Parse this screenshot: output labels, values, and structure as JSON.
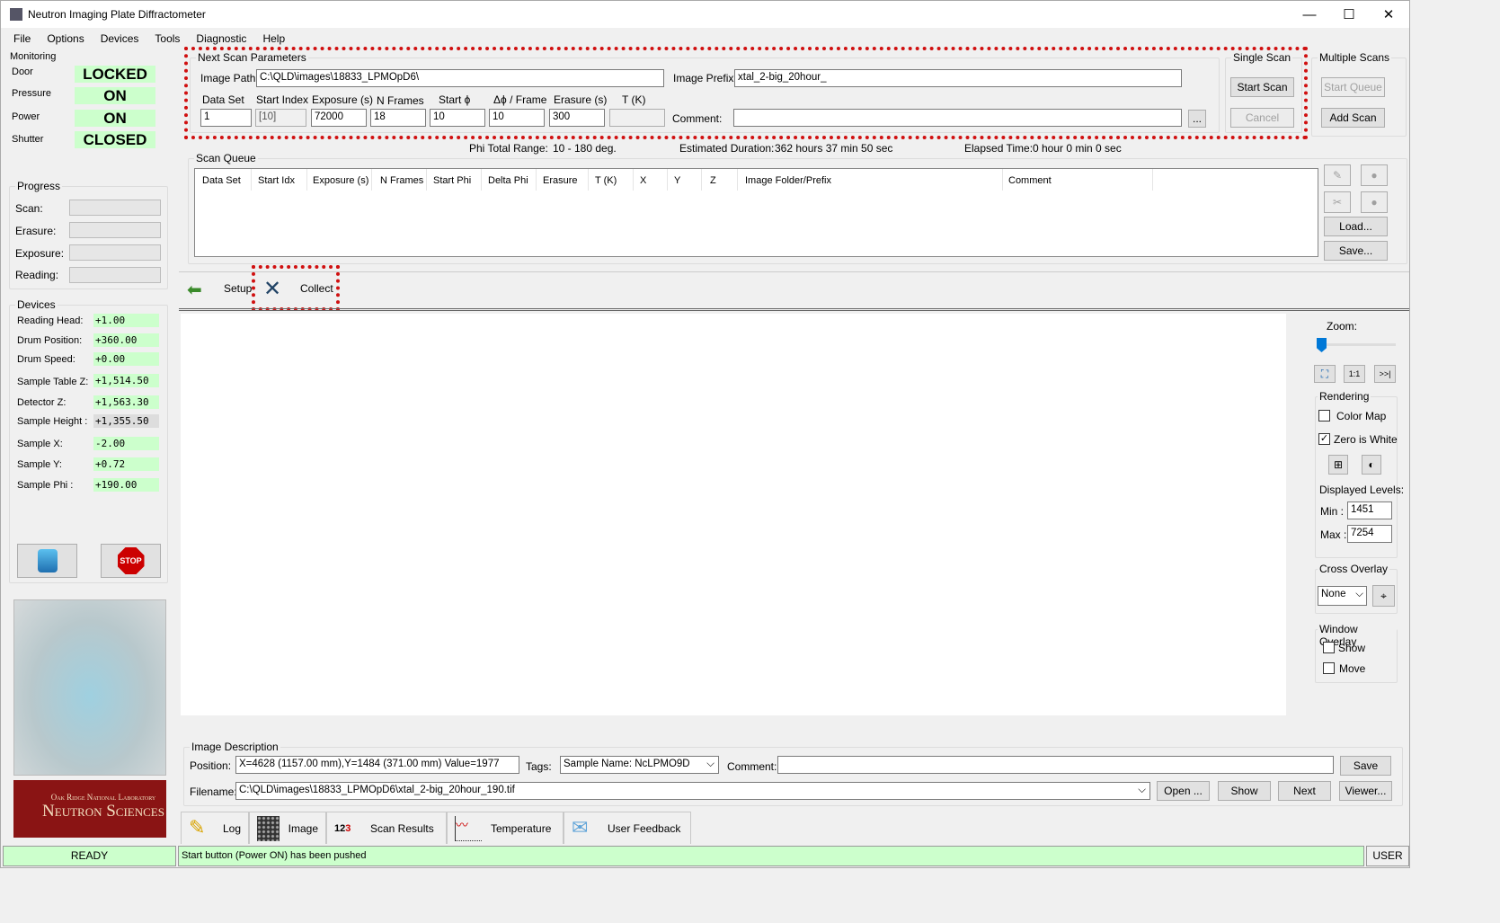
{
  "window": {
    "title": "Neutron Imaging Plate Diffractometer",
    "minimize": "—",
    "maximize": "☐",
    "close": "✕"
  },
  "menu": [
    "File",
    "Options",
    "Devices",
    "Tools",
    "Diagnostic",
    "Help"
  ],
  "monitoring": {
    "label": "Monitoring",
    "items": [
      {
        "label": "Door",
        "value": "LOCKED"
      },
      {
        "label": "Pressure",
        "value": "ON"
      },
      {
        "label": "Power",
        "value": "ON"
      },
      {
        "label": "Shutter",
        "value": "CLOSED"
      }
    ]
  },
  "progress": {
    "label": "Progress",
    "items": [
      "Scan:",
      "Erasure:",
      "Exposure:",
      "Reading:"
    ]
  },
  "devices": {
    "label": "Devices",
    "items": [
      {
        "label": "Reading Head:",
        "value": "+1.00"
      },
      {
        "label": "Drum Position:",
        "value": "+360.00"
      },
      {
        "label": "Drum Speed:",
        "value": "+0.00"
      },
      {
        "label": "Sample Table Z:",
        "value": "+1,514.50"
      },
      {
        "label": "Detector Z:",
        "value": "+1,563.30"
      },
      {
        "label": "Sample Height :",
        "value": "+1,355.50"
      },
      {
        "label": "Sample X:",
        "value": "-2.00"
      },
      {
        "label": "Sample Y:",
        "value": "+0.72"
      },
      {
        "label": "Sample Phi :",
        "value": "+190.00"
      }
    ]
  },
  "stop_label": "STOP",
  "logo": {
    "line1": "Oak Ridge National Laboratory",
    "line2": "Neutron Sciences"
  },
  "next_scan": {
    "label": "Next Scan Parameters",
    "image_path_label": "Image Path:",
    "image_path": "C:\\QLD\\images\\18833_LPMOpD6\\",
    "image_prefix_label": "Image Prefix:",
    "image_prefix": "xtal_2-big_20hour_",
    "fields": [
      {
        "label": "Data Set",
        "value": "1"
      },
      {
        "label": "Start Index",
        "value": "[10]"
      },
      {
        "label": "Exposure (s)",
        "value": "72000"
      },
      {
        "label": "N Frames",
        "value": "18"
      },
      {
        "label": "Start ϕ",
        "value": "10"
      },
      {
        "label": "Δϕ / Frame",
        "value": "10"
      },
      {
        "label": "Erasure (s)",
        "value": "300"
      },
      {
        "label": "T (K)",
        "value": ""
      }
    ],
    "comment_label": "Comment:",
    "comment": "",
    "browse": "..."
  },
  "single_scan": {
    "label": "Single Scan",
    "start": "Start Scan",
    "cancel": "Cancel"
  },
  "multiple_scans": {
    "label": "Multiple Scans",
    "start_queue": "Start Queue",
    "add_scan": "Add Scan"
  },
  "info": {
    "phi_label": "Phi Total Range:",
    "phi": "10 - 180 deg.",
    "dur_label": "Estimated Duration:",
    "dur": "362 hours 37 min 50 sec",
    "elapsed_label": "Elapsed Time:",
    "elapsed": "0 hour 0 min 0 sec"
  },
  "queue": {
    "label": "Scan Queue",
    "columns": [
      "Data Set",
      "Start Idx",
      "Exposure (s)",
      "N Frames",
      "Start Phi",
      "Delta Phi",
      "Erasure",
      "T (K)",
      "X",
      "Y",
      "Z",
      "Image Folder/Prefix",
      "Comment"
    ],
    "load": "Load...",
    "save": "Save..."
  },
  "nav": {
    "setup": "Setup",
    "collect": "Collect"
  },
  "viewer": {
    "zoom_label": "Zoom:",
    "zoom_fit": "⛶",
    "zoom_1to1": "1:1",
    "zoom_next": ">>|",
    "zoom_value": 0,
    "rendering": "Rendering",
    "color_map": "Color Map",
    "color_map_checked": false,
    "zero_white": "Zero is White",
    "zero_white_checked": true,
    "levels": "Displayed Levels:",
    "min_label": "Min :",
    "min": "1451",
    "max_label": "Max :",
    "max": "7254",
    "cross": "Cross Overlay",
    "cross_value": "None",
    "window_overlay": "Window Overlay",
    "show": "Show",
    "move": "Move"
  },
  "description": {
    "label": "Image Description",
    "position_label": "Position:",
    "position": "X=4628 (1157.00 mm),Y=1484 (371.00 mm) Value=1977",
    "tags_label": "Tags:",
    "tags": "Sample Name: NcLPMO9D",
    "comment_label": "Comment:",
    "comment": "",
    "save": "Save",
    "filename_label": "Filename:",
    "filename": "C:\\QLD\\images\\18833_LPMOpD6\\xtal_2-big_20hour_190.tif",
    "open": "Open ...",
    "show": "Show",
    "next": "Next",
    "viewer": "Viewer..."
  },
  "tabs": [
    "Log",
    "Image",
    "Scan Results",
    "Temperature",
    "User Feedback"
  ],
  "status": {
    "state": "READY",
    "message": "Start button (Power ON) has been pushed",
    "user": "USER"
  },
  "colors": {
    "ok": "#ccffcc",
    "highlight": "#d01010"
  }
}
